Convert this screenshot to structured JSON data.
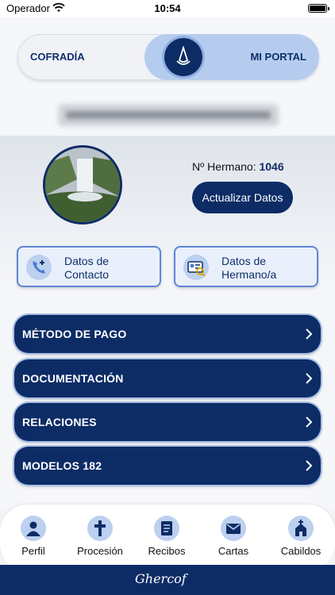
{
  "status_bar": {
    "carrier": "Operador",
    "time": "10:54"
  },
  "portal_toggle": {
    "left_label": "COFRADÍA",
    "right_label": "MI PORTAL",
    "selected": "MI PORTAL"
  },
  "profile": {
    "member_number_label": "Nº Hermano:",
    "member_number": "1046",
    "update_button": "Actualizar Datos"
  },
  "cards": [
    {
      "line1": "Datos de",
      "line2": "Contacto",
      "icon": "phone-plus-icon"
    },
    {
      "line1": "Datos de",
      "line2": "Hermano/a",
      "icon": "id-card-icon"
    }
  ],
  "menu": [
    {
      "label": "MÉTODO DE PAGO"
    },
    {
      "label": "DOCUMENTACIÓN"
    },
    {
      "label": "RELACIONES"
    },
    {
      "label": "MODELOS 182"
    }
  ],
  "tabs": [
    {
      "label": "Perfil",
      "icon": "person-icon"
    },
    {
      "label": "Procesión",
      "icon": "cross-icon"
    },
    {
      "label": "Recibos",
      "icon": "receipt-icon"
    },
    {
      "label": "Cartas",
      "icon": "mail-icon"
    },
    {
      "label": "Cabildos",
      "icon": "church-icon"
    }
  ],
  "footer": {
    "logo_text": "Ghercof"
  },
  "colors": {
    "navy": "#0d2c66",
    "light_blue": "#b6ccef",
    "accent_border": "#5d87d6"
  }
}
